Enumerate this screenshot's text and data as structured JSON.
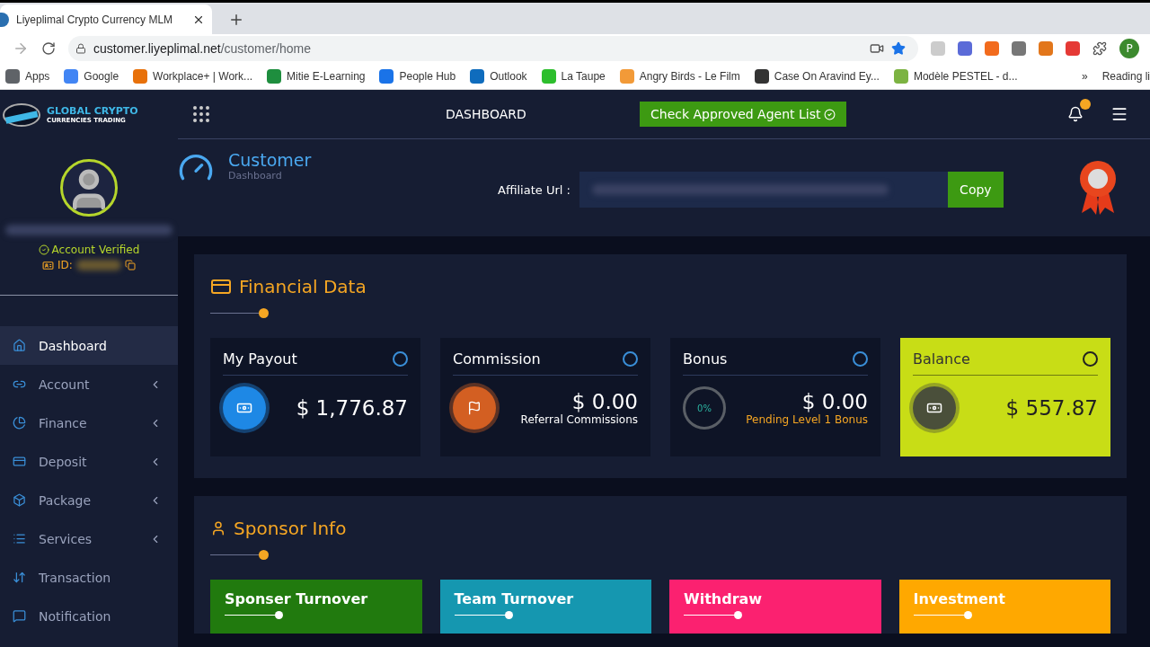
{
  "browser": {
    "tab_title": "Liyeplimal Crypto Currency MLM",
    "url_host": "customer.liyeplimal.net",
    "url_path": "/customer/home",
    "bookmarks": [
      {
        "label": "Apps",
        "color": "#5f6368"
      },
      {
        "label": "Google",
        "color": "#4285f4"
      },
      {
        "label": "Workplace+ | Work...",
        "color": "#e8710a"
      },
      {
        "label": "Mitie E-Learning",
        "color": "#1e8e3e"
      },
      {
        "label": "People Hub",
        "color": "#1a73e8"
      },
      {
        "label": "Outlook",
        "color": "#0f6cbd"
      },
      {
        "label": "La Taupe",
        "color": "#2dbe2d"
      },
      {
        "label": "Angry Birds - Le Film",
        "color": "#f29a38"
      },
      {
        "label": "Case On Aravind Ey...",
        "color": "#333333"
      },
      {
        "label": "Modèle PESTEL - d...",
        "color": "#7cb342"
      }
    ],
    "more": "»",
    "reading_list": "Reading li",
    "profile_initial": "P"
  },
  "brand": {
    "line1": "GLOBAL CRYPTO",
    "line2": "CURRENCIES TRADING"
  },
  "header": {
    "title": "DASHBOARD",
    "agent_button": "Check Approved Agent List"
  },
  "profile": {
    "status": "Account Verified",
    "id_label": "ID:"
  },
  "sidebar": {
    "items": [
      {
        "label": "Dashboard",
        "selected": true,
        "has_submenu": false
      },
      {
        "label": "Account",
        "selected": false,
        "has_submenu": true
      },
      {
        "label": "Finance",
        "selected": false,
        "has_submenu": true
      },
      {
        "label": "Deposit",
        "selected": false,
        "has_submenu": true
      },
      {
        "label": "Package",
        "selected": false,
        "has_submenu": true
      },
      {
        "label": "Services",
        "selected": false,
        "has_submenu": true
      },
      {
        "label": "Transaction",
        "selected": false,
        "has_submenu": false
      },
      {
        "label": "Notification",
        "selected": false,
        "has_submenu": false
      }
    ]
  },
  "page_title": {
    "title": "Customer",
    "subtitle": "Dashboard"
  },
  "affiliate": {
    "label": "Affiliate Url :",
    "copy_button": "Copy"
  },
  "financial": {
    "title": "Financial Data",
    "cards": [
      {
        "kind": "icon",
        "title": "My Payout",
        "amount": "1,776.87",
        "currency": "$",
        "highlighted": false,
        "color": "#1e88e5"
      },
      {
        "kind": "icon",
        "title": "Commission",
        "amount": "0.00",
        "currency": "$",
        "note": "Referral Commissions",
        "highlighted": false,
        "color": "#d35f22"
      },
      {
        "kind": "ring",
        "title": "Bonus",
        "amount": "0.00",
        "currency": "$",
        "note": "Pending Level 1 Bonus",
        "ring_label": "0%",
        "highlighted": false,
        "color": "#5a5f66"
      },
      {
        "kind": "icon",
        "title": "Balance",
        "amount": "557.87",
        "currency": "$",
        "highlighted": true,
        "color": "#4a4f3a"
      }
    ]
  },
  "sponsor": {
    "title": "Sponsor Info",
    "cards": [
      {
        "title": "Sponser Turnover",
        "color": "#217a0e"
      },
      {
        "title": "Team Turnover",
        "color": "#1597b0"
      },
      {
        "title": "Withdraw",
        "color": "#fb2170"
      },
      {
        "title": "Investment",
        "color": "#ffa800"
      }
    ]
  }
}
